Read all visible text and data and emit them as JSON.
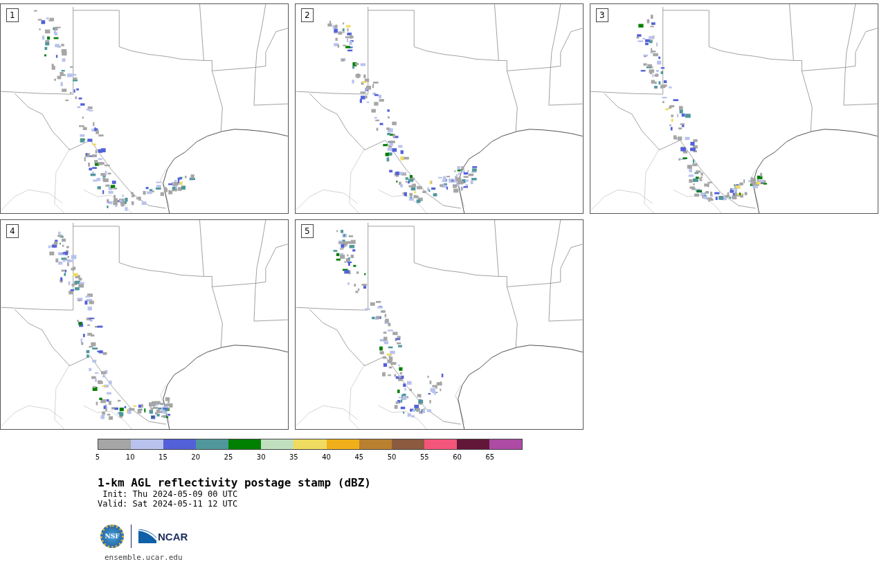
{
  "panels": [
    {
      "label": "1"
    },
    {
      "label": "2"
    },
    {
      "label": "3"
    },
    {
      "label": "4"
    },
    {
      "label": "5"
    }
  ],
  "colorbar": {
    "bins": [
      {
        "color": "#a6a6a6"
      },
      {
        "color": "#b8c2ec"
      },
      {
        "color": "#5361d9"
      },
      {
        "color": "#4f979b"
      },
      {
        "color": "#008000"
      },
      {
        "color": "#bfdfbf"
      },
      {
        "color": "#efdb5f"
      },
      {
        "color": "#efaf1b"
      },
      {
        "color": "#b98030"
      },
      {
        "color": "#8b5a3f"
      },
      {
        "color": "#f4557a"
      },
      {
        "color": "#621738"
      },
      {
        "color": "#ad4ba5"
      }
    ],
    "ticks": [
      "5",
      "10",
      "15",
      "20",
      "25",
      "30",
      "35",
      "40",
      "45",
      "50",
      "55",
      "60",
      "65"
    ]
  },
  "title": "1-km AGL reflectivity postage stamp (dBZ)",
  "init": " Init: Thu 2024-05-09 00 UTC",
  "valid": "Valid: Sat 2024-05-11 12 UTC",
  "logos": {
    "nsf": "NSF",
    "ncar": "NCAR"
  },
  "url": "ensemble.ucar.edu"
}
